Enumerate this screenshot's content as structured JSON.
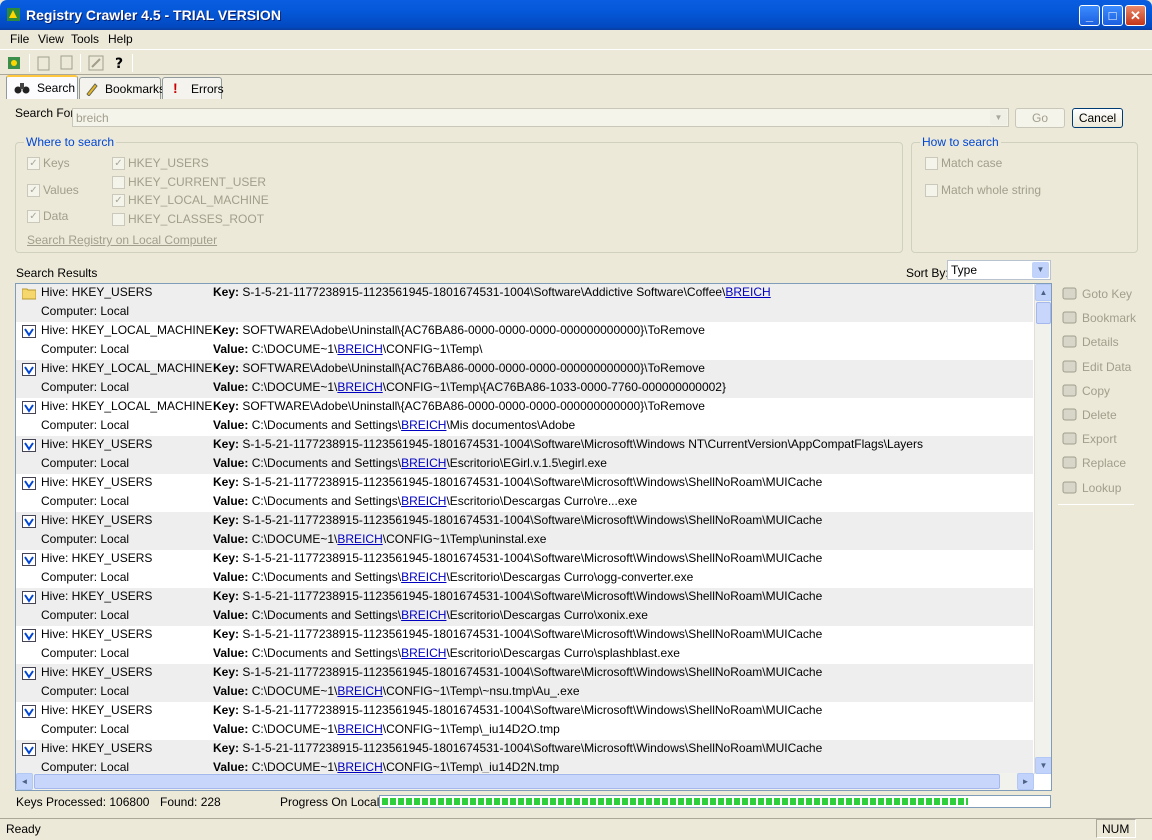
{
  "window": {
    "title": "Registry Crawler 4.5 - TRIAL VERSION"
  },
  "menu": [
    "File",
    "View",
    "Tools",
    "Help"
  ],
  "tabs": [
    {
      "label": "Search",
      "icon": "binoculars-icon"
    },
    {
      "label": "Bookmarks",
      "icon": "pencil-icon"
    },
    {
      "label": "Errors",
      "icon": "exclamation-icon"
    }
  ],
  "search": {
    "label": "Search For:",
    "value": "breich",
    "go_label": "Go",
    "cancel_label": "Cancel"
  },
  "where": {
    "title": "Where to search",
    "keys": "Keys",
    "values": "Values",
    "data": "Data",
    "hkey_users": "HKEY_USERS",
    "hkey_current_user": "HKEY_CURRENT_USER",
    "hkey_local_machine": "HKEY_LOCAL_MACHINE",
    "hkey_classes_root": "HKEY_CLASSES_ROOT",
    "link": "Search Registry on Local Computer"
  },
  "how": {
    "title": "How to search",
    "match_case": "Match case",
    "match_whole": "Match whole string"
  },
  "results": {
    "label": "Search Results",
    "sort_label": "Sort By:",
    "sort_value": "Type",
    "rows": [
      {
        "hive": "Hive: HKEY_USERS",
        "computer": "Computer: Local",
        "key_pre": "S-1-5-21-1177238915-1123561945-1801674531-1004\\Software\\Addictive Software\\Coffee\\",
        "key_link": "BREICH",
        "key_post": "",
        "value_pre": "",
        "value_link": "",
        "value_post": ""
      },
      {
        "hive": "Hive: HKEY_LOCAL_MACHINE",
        "computer": "Computer: Local",
        "key_pre": "SOFTWARE\\Adobe\\Uninstall\\{AC76BA86-0000-0000-0000-000000000000}\\ToRemove",
        "key_link": "",
        "key_post": "",
        "value_pre": "C:\\DOCUME~1\\",
        "value_link": "BREICH",
        "value_post": "\\CONFIG~1\\Temp\\"
      },
      {
        "hive": "Hive: HKEY_LOCAL_MACHINE",
        "computer": "Computer: Local",
        "key_pre": "SOFTWARE\\Adobe\\Uninstall\\{AC76BA86-0000-0000-0000-000000000000}\\ToRemove",
        "key_link": "",
        "key_post": "",
        "value_pre": "C:\\DOCUME~1\\",
        "value_link": "BREICH",
        "value_post": "\\CONFIG~1\\Temp\\{AC76BA86-1033-0000-7760-000000000002}"
      },
      {
        "hive": "Hive: HKEY_LOCAL_MACHINE",
        "computer": "Computer: Local",
        "key_pre": "SOFTWARE\\Adobe\\Uninstall\\{AC76BA86-0000-0000-0000-000000000000}\\ToRemove",
        "key_link": "",
        "key_post": "",
        "value_pre": "C:\\Documents and Settings\\",
        "value_link": "BREICH",
        "value_post": "\\Mis documentos\\Adobe"
      },
      {
        "hive": "Hive: HKEY_USERS",
        "computer": "Computer: Local",
        "key_pre": "S-1-5-21-1177238915-1123561945-1801674531-1004\\Software\\Microsoft\\Windows NT\\CurrentVersion\\AppCompatFlags\\Layers",
        "key_link": "",
        "key_post": "",
        "value_pre": "C:\\Documents and Settings\\",
        "value_link": "BREICH",
        "value_post": "\\Escritorio\\EGirl.v.1.5\\egirl.exe"
      },
      {
        "hive": "Hive: HKEY_USERS",
        "computer": "Computer: Local",
        "key_pre": "S-1-5-21-1177238915-1123561945-1801674531-1004\\Software\\Microsoft\\Windows\\ShellNoRoam\\MUICache",
        "key_link": "",
        "key_post": "",
        "value_pre": "C:\\Documents and Settings\\",
        "value_link": "BREICH",
        "value_post": "\\Escritorio\\Descargas Curro\\re...exe"
      },
      {
        "hive": "Hive: HKEY_USERS",
        "computer": "Computer: Local",
        "key_pre": "S-1-5-21-1177238915-1123561945-1801674531-1004\\Software\\Microsoft\\Windows\\ShellNoRoam\\MUICache",
        "key_link": "",
        "key_post": "",
        "value_pre": "C:\\DOCUME~1\\",
        "value_link": "BREICH",
        "value_post": "\\CONFIG~1\\Temp\\uninstal.exe"
      },
      {
        "hive": "Hive: HKEY_USERS",
        "computer": "Computer: Local",
        "key_pre": "S-1-5-21-1177238915-1123561945-1801674531-1004\\Software\\Microsoft\\Windows\\ShellNoRoam\\MUICache",
        "key_link": "",
        "key_post": "",
        "value_pre": "C:\\Documents and Settings\\",
        "value_link": "BREICH",
        "value_post": "\\Escritorio\\Descargas Curro\\ogg-converter.exe"
      },
      {
        "hive": "Hive: HKEY_USERS",
        "computer": "Computer: Local",
        "key_pre": "S-1-5-21-1177238915-1123561945-1801674531-1004\\Software\\Microsoft\\Windows\\ShellNoRoam\\MUICache",
        "key_link": "",
        "key_post": "",
        "value_pre": "C:\\Documents and Settings\\",
        "value_link": "BREICH",
        "value_post": "\\Escritorio\\Descargas Curro\\xonix.exe"
      },
      {
        "hive": "Hive: HKEY_USERS",
        "computer": "Computer: Local",
        "key_pre": "S-1-5-21-1177238915-1123561945-1801674531-1004\\Software\\Microsoft\\Windows\\ShellNoRoam\\MUICache",
        "key_link": "",
        "key_post": "",
        "value_pre": "C:\\Documents and Settings\\",
        "value_link": "BREICH",
        "value_post": "\\Escritorio\\Descargas Curro\\splashblast.exe"
      },
      {
        "hive": "Hive: HKEY_USERS",
        "computer": "Computer: Local",
        "key_pre": "S-1-5-21-1177238915-1123561945-1801674531-1004\\Software\\Microsoft\\Windows\\ShellNoRoam\\MUICache",
        "key_link": "",
        "key_post": "",
        "value_pre": "C:\\DOCUME~1\\",
        "value_link": "BREICH",
        "value_post": "\\CONFIG~1\\Temp\\~nsu.tmp\\Au_.exe"
      },
      {
        "hive": "Hive: HKEY_USERS",
        "computer": "Computer: Local",
        "key_pre": "S-1-5-21-1177238915-1123561945-1801674531-1004\\Software\\Microsoft\\Windows\\ShellNoRoam\\MUICache",
        "key_link": "",
        "key_post": "",
        "value_pre": "C:\\DOCUME~1\\",
        "value_link": "BREICH",
        "value_post": "\\CONFIG~1\\Temp\\_iu14D2O.tmp"
      },
      {
        "hive": "Hive: HKEY_USERS",
        "computer": "Computer: Local",
        "key_pre": "S-1-5-21-1177238915-1123561945-1801674531-1004\\Software\\Microsoft\\Windows\\ShellNoRoam\\MUICache",
        "key_link": "",
        "key_post": "",
        "value_pre": "C:\\DOCUME~1\\",
        "value_link": "BREICH",
        "value_post": "\\CONFIG~1\\Temp\\_iu14D2N.tmp"
      }
    ],
    "key_label": "Key:",
    "value_label": "Value:"
  },
  "side_buttons": [
    {
      "label": "Goto Key",
      "icon": "goto-key-icon"
    },
    {
      "label": "Bookmark",
      "icon": "bookmark-icon"
    },
    {
      "label": "Details",
      "icon": "details-icon"
    },
    {
      "label": "Edit Data",
      "icon": "edit-data-icon"
    },
    {
      "label": "Copy",
      "icon": "copy-icon"
    },
    {
      "label": "Delete",
      "icon": "delete-icon"
    },
    {
      "label": "Export",
      "icon": "export-icon"
    },
    {
      "label": "Replace",
      "icon": "replace-icon"
    },
    {
      "label": "Lookup",
      "icon": "lookup-icon"
    }
  ],
  "progress": {
    "keys_processed": "Keys Processed: 106800",
    "found": "Found: 228",
    "label": "Progress On Local:",
    "fraction": 0.88
  },
  "status": {
    "text": "Ready",
    "num": "NUM"
  }
}
